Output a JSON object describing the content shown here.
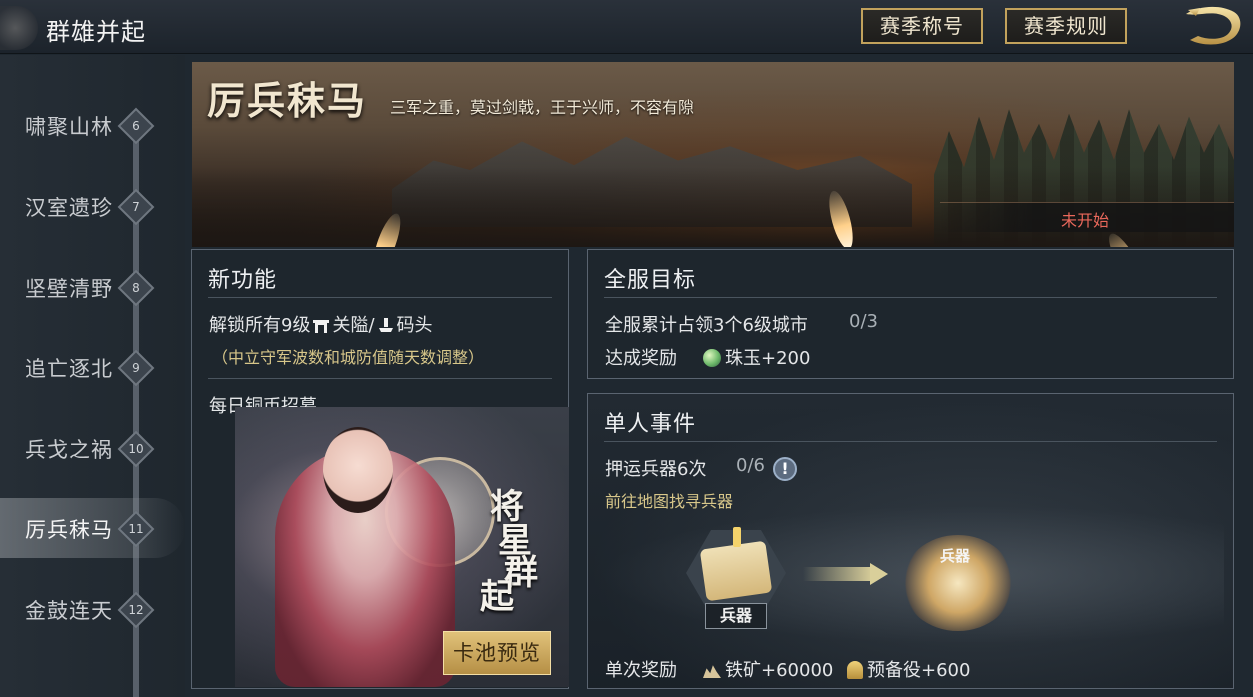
{
  "header": {
    "title": "群雄并起",
    "btn_season_title": "赛季称号",
    "btn_season_rules": "赛季规则"
  },
  "sidebar": {
    "items": [
      {
        "label": "啸聚山林",
        "num": "6"
      },
      {
        "label": "汉室遗珍",
        "num": "7"
      },
      {
        "label": "坚壁清野",
        "num": "8"
      },
      {
        "label": "追亡逐北",
        "num": "9"
      },
      {
        "label": "兵戈之祸",
        "num": "10"
      },
      {
        "label": "厉兵秣马",
        "num": "11",
        "active": true
      },
      {
        "label": "金鼓连天",
        "num": "12"
      }
    ]
  },
  "banner": {
    "title": "厉兵秣马",
    "subtitle": "三军之重，莫过剑戟，王于兴师，不容有隙",
    "status": "未开始"
  },
  "new_features": {
    "heading": "新功能",
    "unlock_text_a": "解锁所有9级",
    "unlock_pass": "关隘/",
    "unlock_dock": "码头",
    "note": "（中立守军波数和城防值随天数调整）",
    "daily": "每日铜币招募",
    "vertical_title": [
      "将",
      "星",
      "群",
      "起"
    ],
    "preview_button": "卡池预览"
  },
  "server_goal": {
    "heading": "全服目标",
    "goal": "全服累计占领3个6级城市",
    "progress": "0/3",
    "reward_label": "达成奖励",
    "reward": "珠玉+200"
  },
  "single_event": {
    "heading": "单人事件",
    "task": "押运兵器6次",
    "progress": "0/6",
    "hint": "前往地图找寻兵器",
    "node_label": "兵器",
    "target_label": "兵器",
    "reward_label": "单次奖励",
    "reward_ore": "铁矿+60000",
    "reward_reserve": "预备役+600"
  },
  "colors": {
    "accent_gold": "#c2a25c",
    "status_red": "#e9685b",
    "hint_gold": "#d8c78a"
  }
}
